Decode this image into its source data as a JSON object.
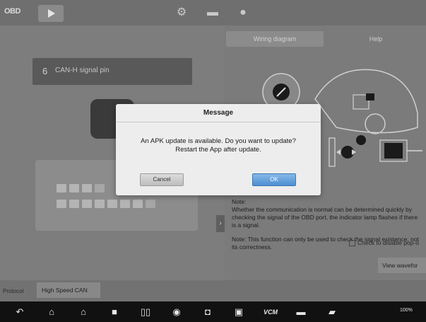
{
  "topbar": {
    "logo_text": "OBD",
    "icons": [
      "play-icon",
      "gear-icon",
      "folder-icon",
      "help-icon"
    ]
  },
  "left": {
    "pin_number": "6",
    "pin_label": "CAN-H signal pin"
  },
  "right": {
    "tabs": [
      {
        "label": "Wiring diagram",
        "active": true
      },
      {
        "label": "Help",
        "active": false
      }
    ],
    "note_title": "Note:",
    "note_body": "Whether the communication is normal can be determined quickly by checking the signal of the OBD port, the indicator lamp flashes if there is a signal.",
    "note_2": "Note: This function can only be used to check the signal existence, not its correctness.",
    "checkbox_label": "Check to disable pop-o"
  },
  "bottom": {
    "protocol_label": "Protocol",
    "protocol_value": "High Speed CAN",
    "view_button": "View wavefor"
  },
  "dialog": {
    "title": "Message",
    "line1": "An APK update is available. Do you want to update?",
    "line2": "Restart the App after update.",
    "cancel": "Cancel",
    "ok": "OK"
  },
  "navbar": {
    "vcm_label": "VCM",
    "status": "100%",
    "icons": [
      "back-icon",
      "home-icon",
      "house-icon",
      "square-icon",
      "split-icon",
      "chrome-icon",
      "camera-icon",
      "screen-record-icon",
      "vcm-icon",
      "car-icon",
      "truck-icon"
    ]
  },
  "colors": {
    "ok_button": "#4d8fd1",
    "dialog_bg": "#ededed",
    "navbar": "#111111"
  }
}
